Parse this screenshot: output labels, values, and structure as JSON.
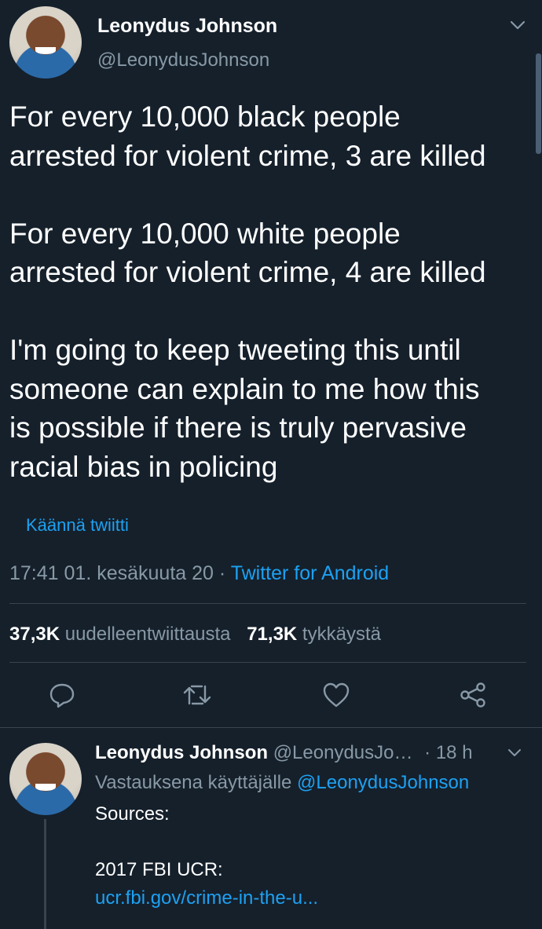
{
  "tweet": {
    "name": "Leonydus Johnson",
    "handle": "@LeonydusJohnson",
    "text": "For every 10,000 black people\narrested for violent crime, 3 are killed\n\nFor every 10,000 white people\narrested for violent crime, 4 are killed\n\nI'm going to keep tweeting this until\nsomeone can explain to me how this\nis possible if there is truly pervasive\nracial bias in policing",
    "translate_label": "Käännä twiitti",
    "timestamp": "17:41 01. kesäkuuta 20",
    "separator": "·",
    "source": "Twitter for Android",
    "retweets_count": "37,3K",
    "retweets_label": "uudelleentwiittausta",
    "likes_count": "71,3K",
    "likes_label": "tykkäystä"
  },
  "icons": {
    "menu": "chevron-down-icon",
    "reply": "reply-icon",
    "retweet": "retweet-icon",
    "like": "heart-icon",
    "share": "share-icon"
  },
  "reply": {
    "name": "Leonydus Johnson",
    "handle": "@LeonydusJo…",
    "separator": "·",
    "time": "18 h",
    "replying_prefix": "Vastauksena käyttäjälle",
    "replying_handle": "@LeonydusJohnson",
    "text_line1": "Sources:",
    "text_line2": "2017 FBI UCR:",
    "link": "ucr.fbi.gov/crime-in-the-u..."
  },
  "colors": {
    "background": "#15202b",
    "accent": "#1da1f2",
    "muted": "#8899a6",
    "divider": "#38444d"
  }
}
